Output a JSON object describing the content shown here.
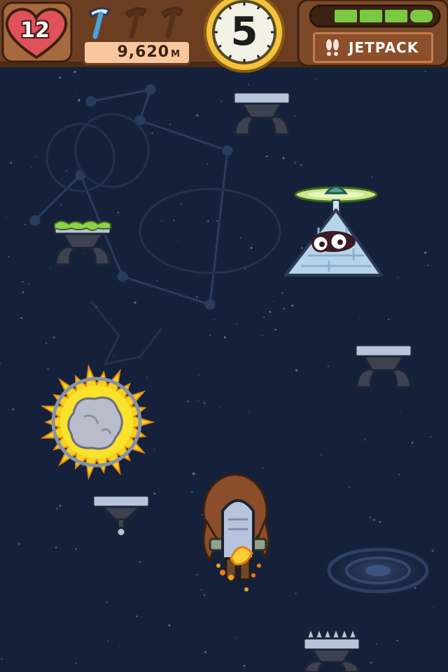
{
  "hud": {
    "lives": "12",
    "distance_value": "9,620",
    "distance_unit": "M",
    "timer": "5",
    "jetpack_label": "JETPACK",
    "jetpack_fuel_segments": 4,
    "pickaxes_total": 3,
    "pickaxes_available": 1
  },
  "colors": {
    "space_bg": "#15213a",
    "hud_wood": "#6b3e22",
    "fuel_green": "#7ac943",
    "heart_red": "#e0525a",
    "platform_steel": "#b7c4dc",
    "slime_green": "#8ed14b"
  },
  "icons": {
    "lives": "heart-icon",
    "pickaxe": "pickaxe-icon",
    "timer": "stopwatch-icon",
    "jetpack": "footprints-icon"
  }
}
